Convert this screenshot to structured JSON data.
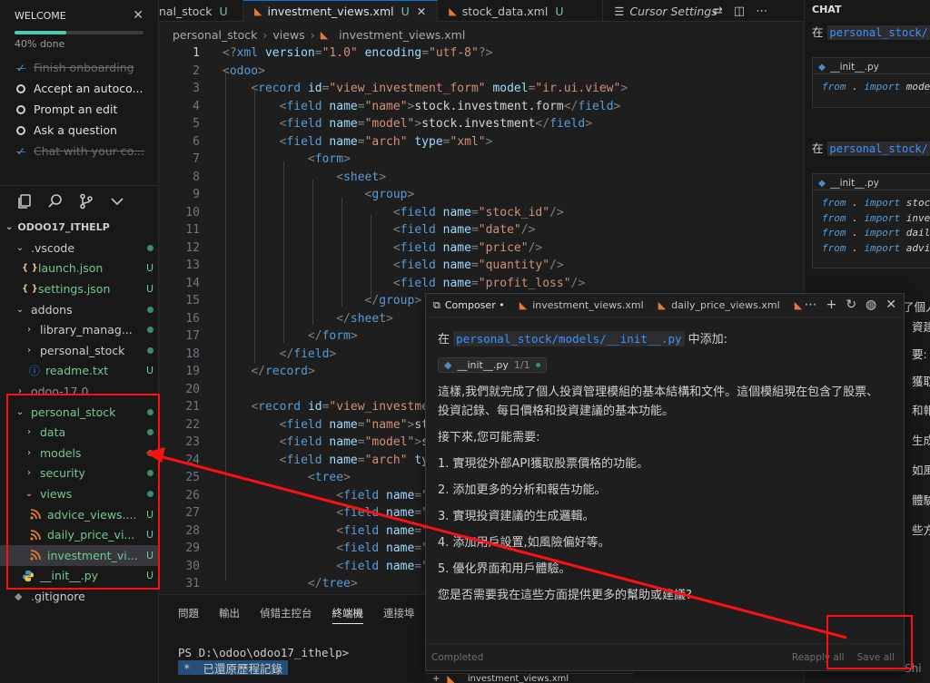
{
  "welcome": {
    "title": "WELCOME",
    "progress_label": "40% done",
    "progress_fraction": 0.4,
    "steps": [
      {
        "label": "Finish onboarding",
        "done": true
      },
      {
        "label": "Accept an autoco...",
        "done": false
      },
      {
        "label": "Prompt an edit",
        "done": false
      },
      {
        "label": "Ask a question",
        "done": false
      },
      {
        "label": "Chat with your co...",
        "done": true
      }
    ]
  },
  "explorer": {
    "project": "ODOO17_ITHELP",
    "items": [
      {
        "name": ".vscode",
        "status": "•"
      },
      {
        "name": "launch.json",
        "status": "U"
      },
      {
        "name": "settings.json",
        "status": "U"
      },
      {
        "name": "addons",
        "status": "•"
      },
      {
        "name": "library_manag...",
        "status": "•"
      },
      {
        "name": "personal_stock",
        "status": "•"
      },
      {
        "name": "readme.txt",
        "status": "U"
      },
      {
        "name": "odoo-17.0",
        "status": ""
      },
      {
        "name": "personal_stock",
        "status": "•"
      },
      {
        "name": "data",
        "status": "•"
      },
      {
        "name": "models",
        "status": "•"
      },
      {
        "name": "security",
        "status": "•"
      },
      {
        "name": "views",
        "status": "•"
      },
      {
        "name": "advice_views....",
        "status": "U"
      },
      {
        "name": "daily_price_vi...",
        "status": "U"
      },
      {
        "name": "investment_vi...",
        "status": "U"
      },
      {
        "name": "__init__.py",
        "status": "U"
      },
      {
        "name": ".gitignore",
        "status": ""
      }
    ]
  },
  "tabs": [
    {
      "label": "nal_stock",
      "status": "U"
    },
    {
      "label": "investment_views.xml",
      "status": "U"
    },
    {
      "label": "stock_data.xml",
      "status": "U"
    },
    {
      "label": "Cursor Settings",
      "status": ""
    }
  ],
  "breadcrumb": [
    "personal_stock",
    "views",
    "investment_views.xml"
  ],
  "editor": {
    "line_numbers": [
      "1",
      "2",
      "3",
      "4",
      "5",
      "6",
      "7",
      "8",
      "9",
      "10",
      "11",
      "12",
      "13",
      "14",
      "15",
      "16",
      "17",
      "18",
      "19",
      "20",
      "21",
      "22",
      "23",
      "24",
      "25",
      "26",
      "27",
      "28",
      "29",
      "30",
      "31"
    ],
    "current_line": 1
  },
  "panel": {
    "tabs": [
      "問題",
      "輸出",
      "偵錯主控台",
      "終端機",
      "連接埠"
    ],
    "active_tab": "終端機",
    "terminal_line": "PS D:\\odoo\\odoo17_ithelp>",
    "restore_star": "*",
    "restore_msg": "已還原歷程記錄"
  },
  "composer": {
    "tabs": [
      "Composer •",
      "investment_views.xml",
      "daily_price_views.xml"
    ],
    "intro_prefix": "在",
    "intro_path": "personal_stock/models/__init__.py",
    "intro_suffix": "中添加:",
    "chip_label": "__init__.py",
    "chip_count": "1/1",
    "paragraph1": "這樣,我們就完成了個人投資管理模組的基本結構和文件。這個模組現在包含了股票、",
    "paragraph1b": "投資記錄、每日價格和投資建議的基本功能。",
    "next_heading": "接下來,您可能需要:",
    "list": [
      "1. 實現從外部API獲取股票價格的功能。",
      "2. 添加更多的分析和報告功能。",
      "3. 實現投資建議的生成邏輯。",
      "4. 添加用戶設置,如風險偏好等。",
      "5. 優化界面和用戶體驗。"
    ],
    "question": "您是否需要我在這些方面提供更多的幫助或建議?",
    "status": "Completed",
    "reapply": "Reapply all",
    "save_all": "Save all"
  },
  "chat": {
    "title": "CHAT",
    "line1_prefix": "在",
    "line1_path": "personal_stock/",
    "block1_title": "__init__.py",
    "block1_lines": [
      [
        "from",
        ".",
        "import",
        "mode"
      ]
    ],
    "line2_prefix": "在",
    "line2_path": "personal_stock/",
    "block2_title": "__init__.py",
    "block2_lines": [
      [
        "from",
        ".",
        "import",
        "stoc"
      ],
      [
        "from",
        ".",
        "import",
        "inve"
      ],
      [
        "from",
        ".",
        "import",
        "dail"
      ],
      [
        "from",
        ".",
        "import",
        "advi"
      ]
    ],
    "fragments": [
      "了個人",
      "資建",
      "要:",
      "獲取",
      "和報",
      "生成",
      "如風險",
      "體驗",
      "些方"
    ],
    "footer_fragment": "Shi"
  },
  "bottom_tab": {
    "label": "investment_views.xml"
  },
  "colors": {
    "annotation": "#ff1010",
    "accent": "#0078d4",
    "untracked": "#73c991"
  }
}
